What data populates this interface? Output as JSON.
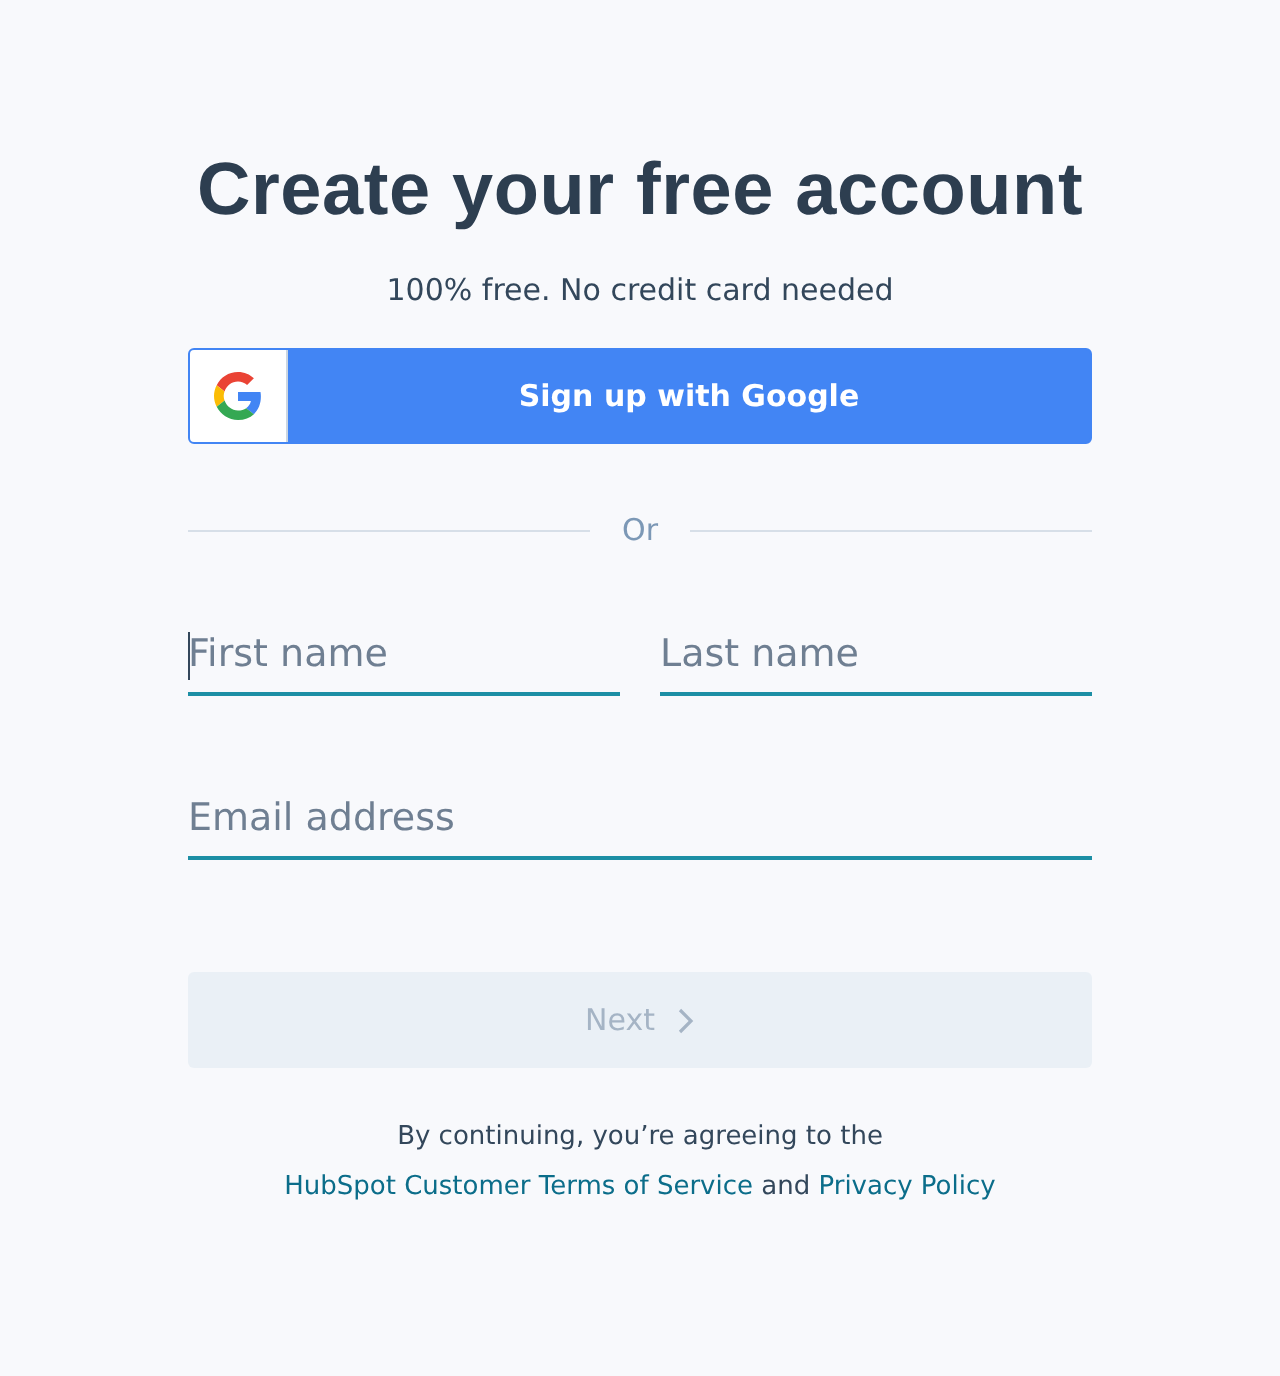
{
  "title": "Create your free account",
  "subtitle": "100% free. No credit card needed",
  "google_button": {
    "label": "Sign up with Google"
  },
  "divider": {
    "label": "Or"
  },
  "fields": [
    {
      "placeholder": "First name",
      "focused": true
    },
    {
      "placeholder": "Last name",
      "focused": false
    },
    {
      "placeholder": "Email address",
      "focused": false
    }
  ],
  "next_button": {
    "label": "Next",
    "disabled": true
  },
  "legal": [
    {
      "kind": "text",
      "text": "By continuing, you’re agreeing to the "
    },
    {
      "kind": "link",
      "text": "HubSpot Customer Terms of Service"
    },
    {
      "kind": "text",
      "text": " and "
    },
    {
      "kind": "link",
      "text": "Privacy Policy"
    }
  ]
}
